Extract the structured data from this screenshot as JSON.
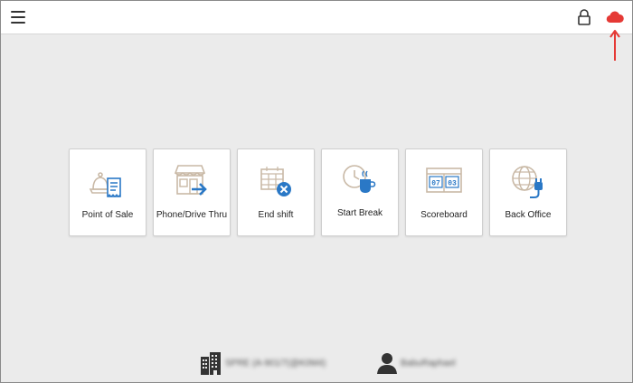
{
  "header": {
    "menu_icon": "hamburger-menu-icon",
    "lock_icon": "lock-icon",
    "cloud_icon": "cloud-icon",
    "accent": "#e53935"
  },
  "tiles": [
    {
      "label": "Point of Sale",
      "icon": "point-of-sale-icon"
    },
    {
      "label": "Phone/Drive Thru",
      "icon": "phone-drive-thru-icon"
    },
    {
      "label": "End shift",
      "icon": "end-shift-icon"
    },
    {
      "label": "Start Break",
      "icon": "start-break-icon"
    },
    {
      "label": "Scoreboard",
      "icon": "scoreboard-icon",
      "digits_left": "07",
      "digits_right": "03"
    },
    {
      "label": "Back Office",
      "icon": "back-office-icon"
    }
  ],
  "footer": {
    "store_icon": "building-icon",
    "store_text": "SPRE (A-901/7(@K0M4)",
    "user_icon": "user-icon",
    "user_text": "BabuRaphael"
  },
  "colors": {
    "tan": "#c9b9a6",
    "blue": "#2a78c6"
  }
}
